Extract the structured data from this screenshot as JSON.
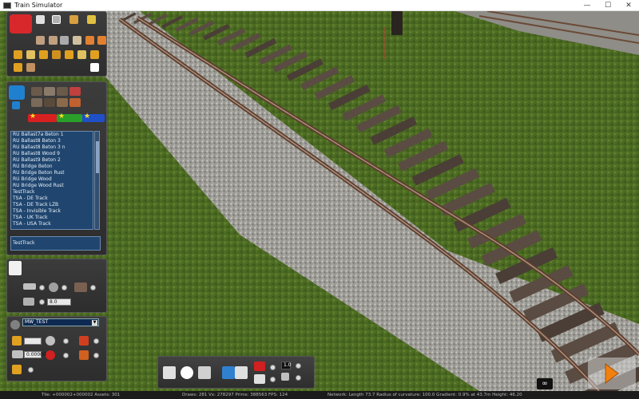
{
  "window": {
    "title": "Train Simulator",
    "controls": [
      "—",
      "☐",
      "✕"
    ]
  },
  "track_list": {
    "items": [
      "RU Ballast7a Beton 1",
      "RU Ballast8 Beton 3",
      "RU Ballast8 Beton 3 n",
      "RU Ballast8 Wood 9",
      "RU Ballast9 Beton 2",
      "RU Bridge Beton",
      "RU Bridge Beton Rust",
      "RU Bridge Wood",
      "RU Bridge Wood Rust",
      "TestTrack",
      "TSA - DE Track",
      "TSA - DE Track LZB",
      "TSA - Invisible Track",
      "TSA - UK Track",
      "TSA - USA Track"
    ],
    "selected": "TestTrack"
  },
  "fields": {
    "spacing_value": "8.0",
    "route_dropdown": "MW_TEST",
    "offset_value": "0.00000",
    "zoom_value": "1.0"
  },
  "status": {
    "tile": "Tile: +000002+000002  Assets: 301",
    "draws": "Draws: 281 Vx: 278297 Prims: 388563 FPS: 124",
    "network": "Network:  Length   73.7 Radius of curvature: 100.0 Gradient:  0.9% at 43.7m Height:  46.20"
  },
  "colors": {
    "panel_bg": "#333333",
    "list_bg": "#20466f",
    "accent_red": "#d82020",
    "accent_green": "#2aa02a",
    "accent_blue": "#2050c8",
    "play_orange": "#f08010"
  }
}
